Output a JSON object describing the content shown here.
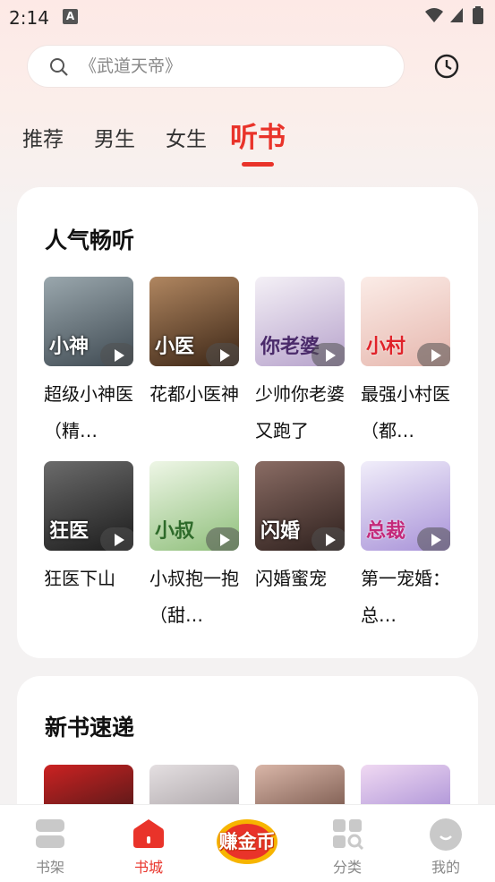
{
  "status_bar": {
    "time": "2:14",
    "notification_letter": "A"
  },
  "search": {
    "placeholder": "《武道天帝》"
  },
  "tabs": [
    {
      "label": "推荐",
      "active": false
    },
    {
      "label": "男生",
      "active": false
    },
    {
      "label": "女生",
      "active": false
    },
    {
      "label": "听书",
      "active": true
    }
  ],
  "sections": [
    {
      "title": "人气畅听",
      "books": [
        {
          "title": "超级小神医（精…",
          "cover_text": "小神",
          "color": "#5d6c76"
        },
        {
          "title": "花都小医神",
          "cover_text": "小医",
          "color": "#6a3f22"
        },
        {
          "title": "少帅你老婆又跑了",
          "cover_text": "你老婆",
          "color": "#d8cfe4"
        },
        {
          "title": "最强小村医（都…",
          "cover_text": "小村",
          "color": "#f1d6cf"
        },
        {
          "title": "狂医下山",
          "cover_text": "狂医",
          "color": "#3a3a3a"
        },
        {
          "title": "小叔抱一抱（甜…",
          "cover_text": "小叔",
          "color": "#cfe3c6"
        },
        {
          "title": "闪婚蜜宠",
          "cover_text": "闪婚",
          "color": "#4e3a36"
        },
        {
          "title": "第一宠婚：总…",
          "cover_text": "总裁",
          "color": "#dcd4ef"
        }
      ]
    },
    {
      "title": "新书速递",
      "books": [
        {
          "color": "#2b2424"
        },
        {
          "color": "#cfc9cc"
        },
        {
          "color": "#7c5246"
        },
        {
          "color": "#c9b6e2"
        }
      ]
    }
  ],
  "bottom_nav": [
    {
      "label": "书架",
      "active": false
    },
    {
      "label": "书城",
      "active": true
    },
    {
      "label": "分类",
      "active": false
    },
    {
      "label": "我的",
      "active": false
    }
  ],
  "earn_button": {
    "label": "赚金币"
  }
}
